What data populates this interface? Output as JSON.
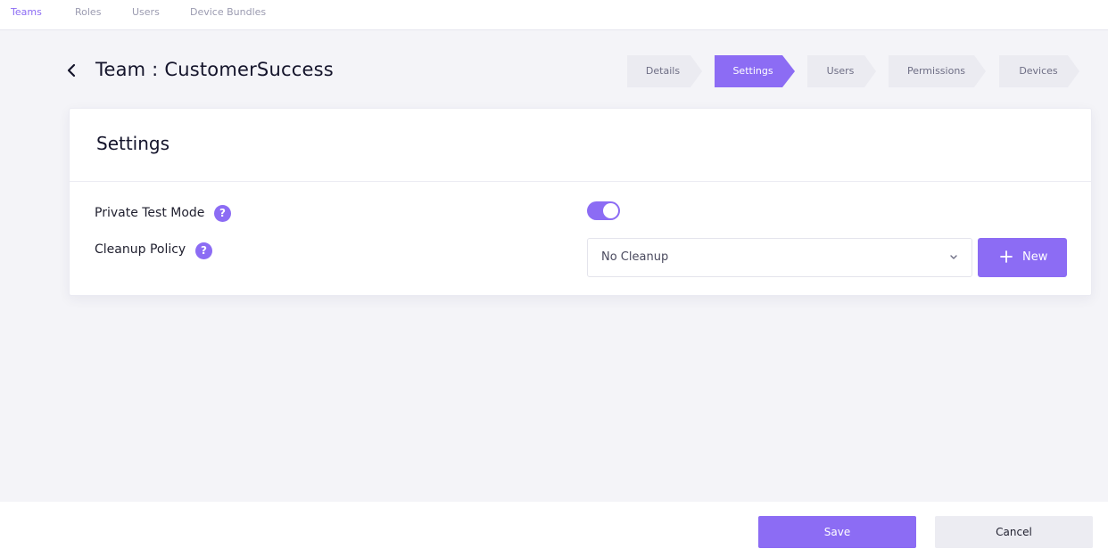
{
  "top_tabs": [
    {
      "label": "Teams",
      "active": true
    },
    {
      "label": "Roles",
      "active": false
    },
    {
      "label": "Users",
      "active": false
    },
    {
      "label": "Device Bundles",
      "active": false
    }
  ],
  "header": {
    "title": "Team : CustomerSuccess",
    "back_icon": "chevron-left-icon"
  },
  "steps": [
    {
      "label": "Details",
      "active": false
    },
    {
      "label": "Settings",
      "active": true
    },
    {
      "label": "Users",
      "active": false
    },
    {
      "label": "Permissions",
      "active": false
    },
    {
      "label": "Devices",
      "active": false
    }
  ],
  "settings_card": {
    "title": "Settings",
    "private_test_mode": {
      "label": "Private Test Mode",
      "help": "?",
      "enabled": true
    },
    "cleanup_policy": {
      "label": "Cleanup Policy",
      "help": "?",
      "selected": "No Cleanup",
      "new_button": "New",
      "new_icon": "plus-icon"
    }
  },
  "footer": {
    "save_label": "Save",
    "cancel_label": "Cancel"
  },
  "colors": {
    "accent": "#8c6cf4",
    "background": "#f4f4f8",
    "step_inactive": "#ebebf1"
  }
}
